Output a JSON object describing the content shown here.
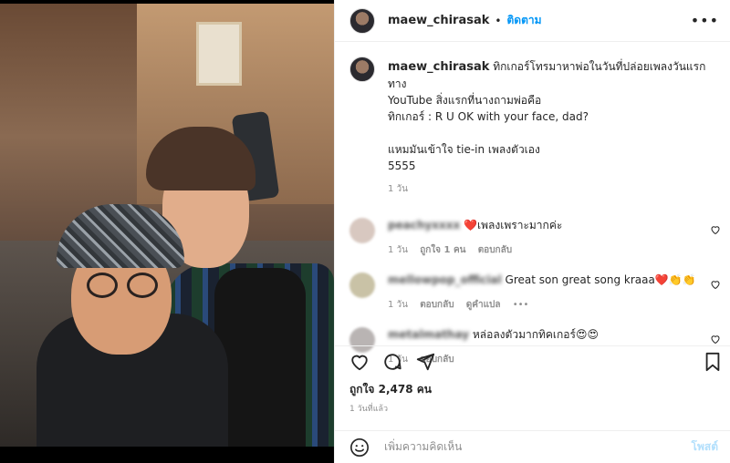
{
  "post": {
    "username": "maew_chirasak",
    "follow_label": "ติดตาม",
    "more_label": "•••",
    "caption_lines": [
      "ทิกเกอร์โทรมาหาพ่อในวันที่ปล่อยเพลงวันแรกทาง",
      "YouTube  สิ่งแรกที่นางถามพ่อคือ ",
      "ทิกเกอร์ : R U OK with your face, dad?",
      "",
      "แหมมันเข้าใจ tie-in เพลงตัวเอง ",
      "5555"
    ],
    "caption_time": "1 วัน"
  },
  "comments": [
    {
      "name": "peachyxxxx",
      "text": "❤️เพลงเพราะมากค่ะ",
      "time": "1 วัน",
      "likes": "ถูกใจ 1 คน",
      "reply": "ตอบกลับ",
      "translate": "",
      "extra": ""
    },
    {
      "name": "mellowpop_official",
      "text": "Great son great song kraaa❤️👏👏",
      "time": "1 วัน",
      "likes": "",
      "reply": "ตอบกลับ",
      "translate": "ดูคำแปล",
      "extra": "•••"
    },
    {
      "name": "metalmathay",
      "text": "หล่อลงตัวมากทิคเกอร์😍😍",
      "time": "1 วัน",
      "likes": "",
      "reply": "ตอบกลับ",
      "translate": "",
      "extra": ""
    }
  ],
  "likes_count": "ถูกใจ 2,478 คน",
  "posted_ago": "1 วันที่แล้ว",
  "add_comment": {
    "placeholder": "เพิ่มความคิดเห็น",
    "post_label": "โพสต์"
  },
  "icons": {
    "like": "heart-icon",
    "comment": "comment-icon",
    "share": "share-icon",
    "save": "bookmark-icon",
    "emoji": "emoji-icon"
  },
  "colors": {
    "accent": "#0095f6",
    "post_disabled": "#b2dffc",
    "muted": "#8e8e8e"
  }
}
